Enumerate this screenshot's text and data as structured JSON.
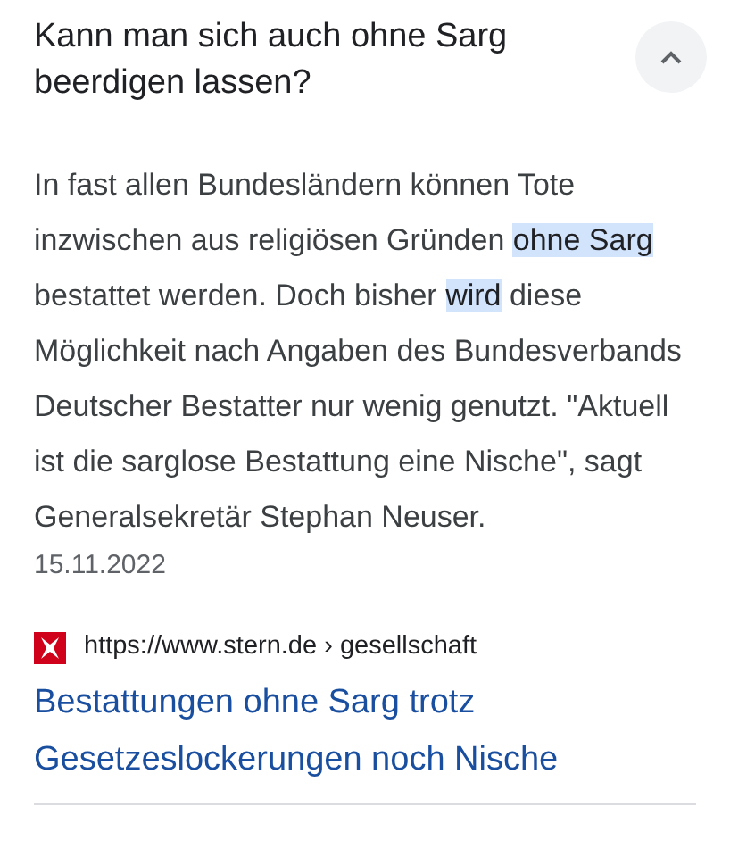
{
  "question": {
    "title": "Kann man sich auch ohne Sarg beerdigen lassen?",
    "expanded": true
  },
  "answer": {
    "segments": [
      {
        "text": "In fast allen Bundesländern können Tote inzwischen aus religiösen Gründen ",
        "highlight": false
      },
      {
        "text": "ohne Sarg",
        "highlight": true
      },
      {
        "text": " bestattet werden. Doch bisher ",
        "highlight": false
      },
      {
        "text": "wird",
        "highlight": true
      },
      {
        "text": " diese Möglichkeit nach Angaben des Bundesverbands Deutscher Bestatter nur wenig genutzt. \"Aktuell ist die sarglose Bestattung eine Nische\", sagt Generalsekretär Stephan Neuser.",
        "highlight": false
      }
    ],
    "date": "15.11.2022"
  },
  "source": {
    "url": "https://www.stern.de › gesellschaft",
    "title": "Bestattungen ohne Sarg trotz Gesetzeslockerungen noch Nische"
  }
}
